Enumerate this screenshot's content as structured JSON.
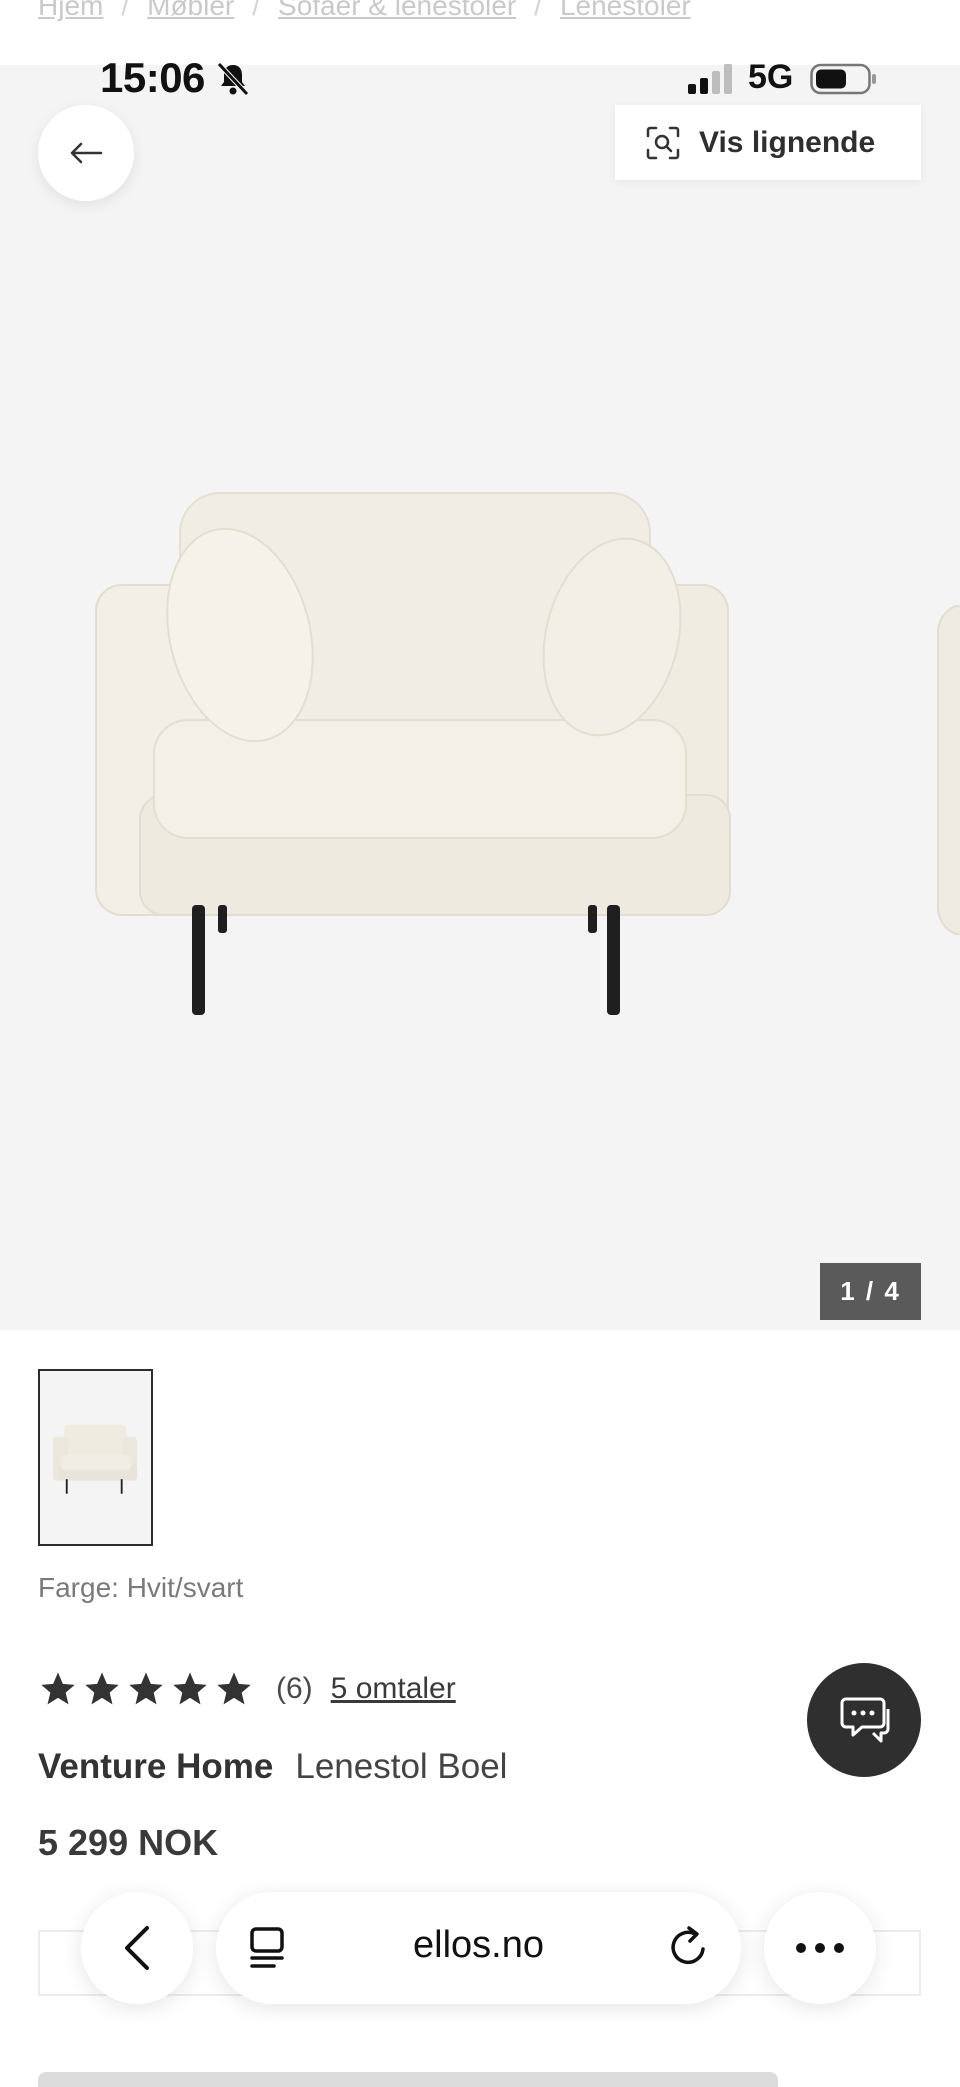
{
  "breadcrumb": {
    "items": [
      "Hjem",
      "Møbler",
      "Sofaer & lenestoler",
      "Lenestoler"
    ],
    "separator": "/"
  },
  "status_bar": {
    "time": "15:06",
    "network": "5G",
    "icons": [
      "bell-slash-icon",
      "signal-icon",
      "battery-icon"
    ]
  },
  "gallery": {
    "visual_search_label": "Vis lignende",
    "counter": "1 / 4",
    "current_index": 1,
    "total": 4
  },
  "product": {
    "color_label": "Farge: Hvit/svart",
    "rating": 5,
    "rating_count": "(6)",
    "reviews_link": "5 omtaler",
    "brand": "Venture Home",
    "name": "Lenestol Boel",
    "price": "5 299 NOK"
  },
  "browser": {
    "url": "ellos.no"
  },
  "colors": {
    "hero_bg": "#f4f4f4",
    "dark": "#2f2f2f",
    "counter_bg": "#5a5a5a",
    "star": "#333333"
  }
}
